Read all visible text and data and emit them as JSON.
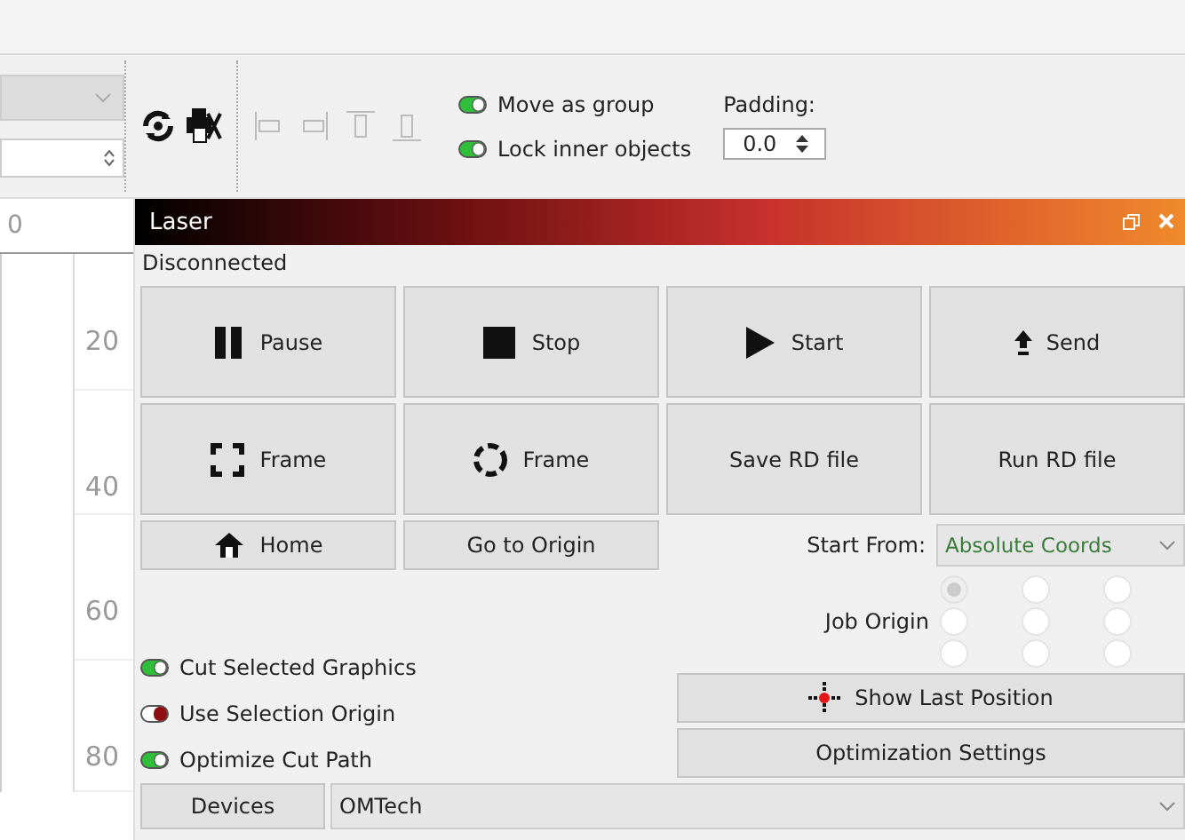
{
  "toolbar": {
    "toggles": [
      {
        "label": "Move as group",
        "on": true
      },
      {
        "label": "Lock inner objects",
        "on": true
      }
    ],
    "padding": {
      "label": "Padding:",
      "value": "0.0"
    }
  },
  "ruler": {
    "top_label": "0",
    "labels": [
      "20",
      "40",
      "60",
      "80"
    ]
  },
  "laser": {
    "title": "Laser",
    "status": "Disconnected",
    "buttons": [
      {
        "label": "Pause",
        "kind": "pause"
      },
      {
        "label": "Stop",
        "kind": "stop"
      },
      {
        "label": "Start",
        "kind": "start"
      },
      {
        "label": "Send",
        "kind": "send"
      },
      {
        "label": "Frame",
        "kind": "frame-square"
      },
      {
        "label": "Frame",
        "kind": "frame-circle"
      },
      {
        "label": "Save RD file",
        "kind": "text"
      },
      {
        "label": "Run RD file",
        "kind": "text"
      }
    ],
    "home": "Home",
    "go_to_origin": "Go to Origin",
    "start_from": {
      "label": "Start From:",
      "value": "Absolute Coords"
    },
    "job_origin": {
      "label": "Job Origin",
      "cells": [
        {
          "selected": true
        },
        {
          "selected": false
        },
        {
          "selected": false
        },
        {
          "selected": false
        },
        {
          "selected": false
        },
        {
          "selected": false
        },
        {
          "selected": false
        },
        {
          "selected": false
        },
        {
          "selected": false
        }
      ]
    },
    "options": [
      {
        "label": "Cut Selected Graphics",
        "on": true
      },
      {
        "label": "Use Selection Origin",
        "on": false
      },
      {
        "label": "Optimize Cut Path",
        "on": true
      }
    ],
    "show_last_position": "Show Last Position",
    "optimization_settings": "Optimization Settings",
    "devices_button": "Devices",
    "device": "OMTech"
  }
}
